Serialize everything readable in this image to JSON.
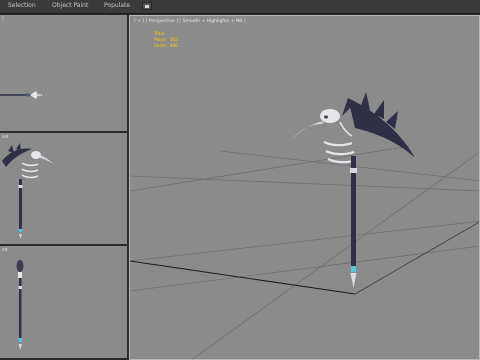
{
  "menu": {
    "selection": "Selection",
    "object_paint": "Object Paint",
    "populate": "Populate"
  },
  "viewports": {
    "top_label": "]",
    "front_label": "ont",
    "left_label": "eft",
    "perspective_label": "[ + ] [ Perspective ] [ Smooth + Highlights + NB ]"
  },
  "stats": {
    "title": "Total",
    "polys_label": "Polys:",
    "polys_value": "582",
    "verts_label": "Verts:",
    "verts_value": "480"
  },
  "colors": {
    "viewport_bg": "#8b8b8b",
    "grid": "#6f6f6f",
    "blade": "#2f3045",
    "bone": "#e6e6ea",
    "gem": "#56c6d8",
    "stats": "#f2d200"
  },
  "icons": {
    "dropdown": "flag-dropdown-icon"
  }
}
